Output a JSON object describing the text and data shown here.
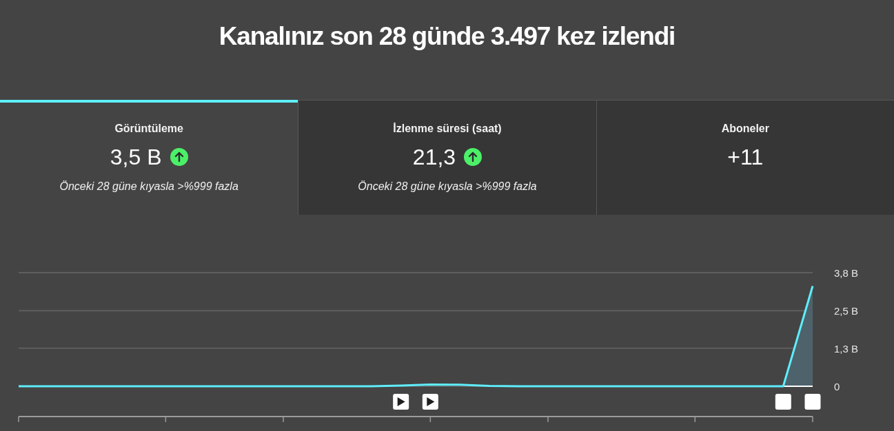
{
  "title": "Kanalınız son 28 günde 3.497 kez izlendi",
  "tabs": [
    {
      "label": "Görüntüleme",
      "value": "3,5 B",
      "rising": true,
      "comparison": "Önceki 28 güne kıyasla >%999 fazla",
      "selected": true
    },
    {
      "label": "İzlenme süresi (saat)",
      "value": "21,3",
      "rising": true,
      "comparison": "Önceki 28 güne kıyasla >%999 fazla",
      "selected": false
    },
    {
      "label": "Aboneler",
      "value": "+11",
      "rising": false,
      "selected": false
    }
  ],
  "chart": {
    "chart_data": {
      "type": "line",
      "values": [
        0,
        0,
        0,
        0,
        0,
        0,
        0,
        0,
        0,
        0,
        0,
        0,
        0,
        0.02,
        0.06,
        0.05,
        0.01,
        0,
        0,
        0,
        0,
        0,
        0,
        0,
        0,
        0,
        0,
        3.35
      ],
      "ylim": [
        0,
        3.8
      ],
      "yticks": [
        {
          "value": 0,
          "label": "0"
        },
        {
          "value": 1.27,
          "label": "1,3 B"
        },
        {
          "value": 2.53,
          "label": "2,5 B"
        },
        {
          "value": 3.8,
          "label": "3,8 B"
        }
      ]
    },
    "markers": [
      {
        "kind": "play"
      },
      {
        "kind": "play"
      },
      {
        "kind": "blank"
      },
      {
        "kind": "blank"
      }
    ]
  }
}
